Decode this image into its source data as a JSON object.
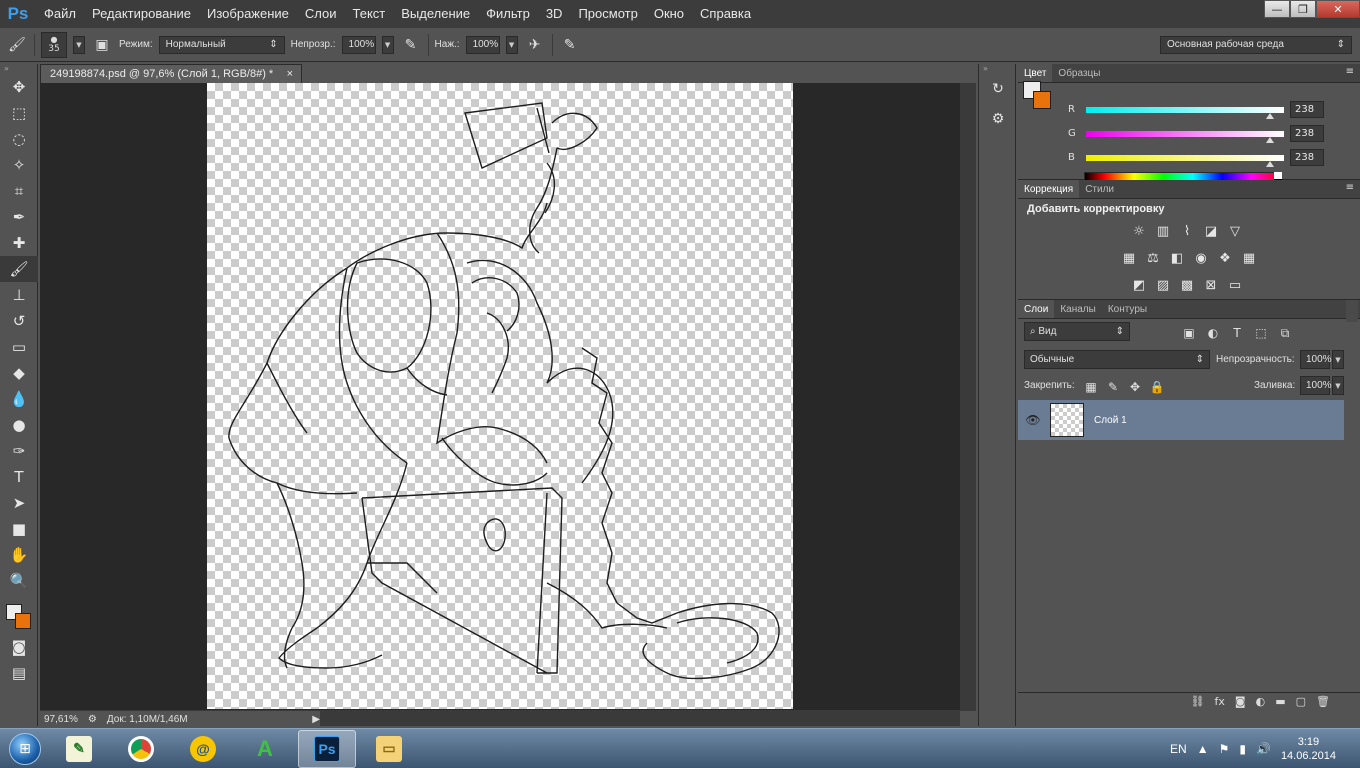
{
  "app": {
    "logo": "Ps"
  },
  "menu": [
    "Файл",
    "Редактирование",
    "Изображение",
    "Слои",
    "Текст",
    "Выделение",
    "Фильтр",
    "3D",
    "Просмотр",
    "Окно",
    "Справка"
  ],
  "window_buttons": {
    "minimize": "—",
    "restore": "❐",
    "close": "✕"
  },
  "options": {
    "brush_size": "35",
    "mode_label": "Режим:",
    "mode_value": "Нормальный",
    "opacity_label": "Непрозр.:",
    "opacity_value": "100%",
    "flow_label": "Наж.:",
    "flow_value": "100%",
    "workspace": "Основная рабочая среда"
  },
  "document": {
    "tab_title": "249198874.psd @ 97,6% (Слой 1, RGB/8#) *",
    "tab_close": "×"
  },
  "status": {
    "zoom": "97,61%",
    "doc_info": "Док: 1,10M/1,46M"
  },
  "color_panel": {
    "tabs": [
      "Цвет",
      "Образцы"
    ],
    "r_label": "R",
    "g_label": "G",
    "b_label": "B",
    "r": "238",
    "g": "238",
    "b": "238",
    "r_level": 0.93,
    "g_level": 0.93,
    "b_level": 0.93,
    "foreground": "#eeeeee",
    "background": "#e8730c"
  },
  "adjustments_panel": {
    "tabs": [
      "Коррекция",
      "Стили"
    ],
    "title": "Добавить корректировку"
  },
  "layers_panel": {
    "tabs": [
      "Слои",
      "Каналы",
      "Контуры"
    ],
    "filter": "Вид",
    "blend_mode": "Обычные",
    "opacity_label": "Непрозрачность:",
    "opacity_value": "100%",
    "lock_label": "Закрепить:",
    "fill_label": "Заливка:",
    "fill_value": "100%",
    "layers": [
      {
        "name": "Слой 1",
        "visible": true,
        "selected": true
      }
    ]
  },
  "taskbar": {
    "language": "EN",
    "time": "3:19",
    "date": "14.06.2014"
  },
  "colors": {
    "accent": "#3ba0f0",
    "selected_layer": "#6a7c94",
    "panel": "#535353",
    "canvas_bg": "#282828"
  }
}
